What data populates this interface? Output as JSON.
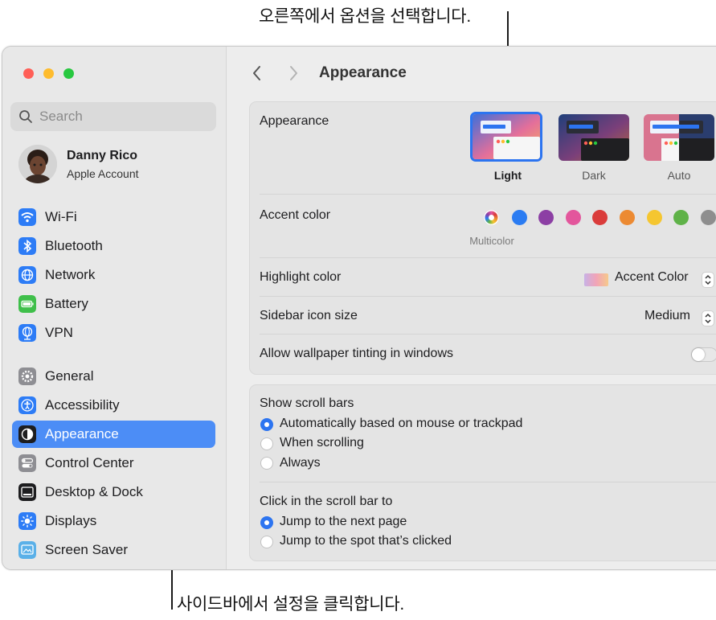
{
  "annotations": {
    "top": "오른쪽에서 옵션을 선택합니다.",
    "bottom": "사이드바에서 설정을 클릭합니다."
  },
  "colors": {
    "selected": "#4c8df6",
    "radio_on": "#2c74f0"
  },
  "sidebar": {
    "search_placeholder": "Search",
    "user": {
      "name": "Danny Rico",
      "subtitle": "Apple Account"
    },
    "items": [
      {
        "label": "Wi-Fi",
        "icon": "wifi-icon",
        "color": "#2d7cf6"
      },
      {
        "label": "Bluetooth",
        "icon": "bluetooth-icon",
        "color": "#2d7cf6"
      },
      {
        "label": "Network",
        "icon": "globe-icon",
        "color": "#2d7cf6"
      },
      {
        "label": "Battery",
        "icon": "battery-icon",
        "color": "#3fbf4a"
      },
      {
        "label": "VPN",
        "icon": "vpn-globe-icon",
        "color": "#2d7cf6"
      },
      {
        "label": "General",
        "icon": "gear-icon",
        "color": "#8e8e93"
      },
      {
        "label": "Accessibility",
        "icon": "accessibility-icon",
        "color": "#2d7cf6"
      },
      {
        "label": "Appearance",
        "icon": "appearance-icon",
        "color": "#1d1d1f",
        "selected": true
      },
      {
        "label": "Control Center",
        "icon": "control-center-icon",
        "color": "#8e8e93"
      },
      {
        "label": "Desktop & Dock",
        "icon": "dock-icon",
        "color": "#1d1d1f"
      },
      {
        "label": "Displays",
        "icon": "sun-icon",
        "color": "#2d7cf6"
      },
      {
        "label": "Screen Saver",
        "icon": "screensaver-icon",
        "color": "#5ab0e8"
      }
    ]
  },
  "main": {
    "title": "Appearance",
    "appearance": {
      "label": "Appearance",
      "options": [
        {
          "label": "Light",
          "selected": true
        },
        {
          "label": "Dark",
          "selected": false
        },
        {
          "label": "Auto",
          "selected": false
        }
      ]
    },
    "accent": {
      "label": "Accent color",
      "selected_name": "Multicolor",
      "colors": [
        "multicolor",
        "#2b7cf2",
        "#8c3fa4",
        "#e3569c",
        "#da3c3b",
        "#ec8a32",
        "#f5c630",
        "#5fb248",
        "#8e8e8e"
      ]
    },
    "highlight": {
      "label": "Highlight color",
      "value": "Accent Color"
    },
    "icon_size": {
      "label": "Sidebar icon size",
      "value": "Medium"
    },
    "tinting": {
      "label": "Allow wallpaper tinting in windows",
      "on": false
    },
    "scroll_bars": {
      "label": "Show scroll bars",
      "options": [
        {
          "label": "Automatically based on mouse or trackpad",
          "selected": true
        },
        {
          "label": "When scrolling",
          "selected": false
        },
        {
          "label": "Always",
          "selected": false
        }
      ]
    },
    "click_scroll": {
      "label": "Click in the scroll bar to",
      "options": [
        {
          "label": "Jump to the next page",
          "selected": true
        },
        {
          "label": "Jump to the spot that’s clicked",
          "selected": false
        }
      ]
    }
  }
}
